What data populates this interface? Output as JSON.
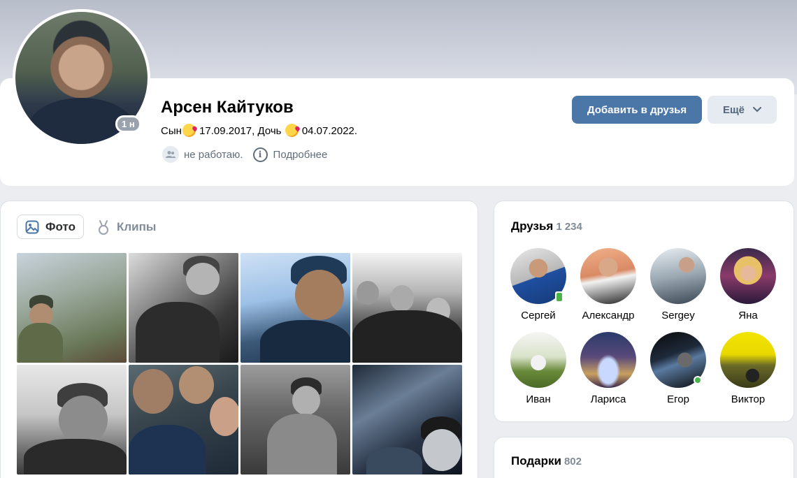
{
  "profile": {
    "name": "Арсен Кайтуков",
    "status_parts": [
      "Сын",
      "17.09.2017, Дочь",
      "04.07.2022."
    ],
    "online_label": "1 н",
    "work": "не работаю.",
    "details": "Подробнее",
    "add_friend": "Добавить в друзья",
    "more": "Ещё"
  },
  "photos": {
    "tabs": [
      {
        "label": "Фото",
        "icon": "image-icon",
        "active": true
      },
      {
        "label": "Клипы",
        "icon": "clips-icon",
        "active": false
      }
    ]
  },
  "friends": {
    "title": "Друзья",
    "count": "1 234",
    "items": [
      {
        "name": "Сергей",
        "online": "mobile"
      },
      {
        "name": "Александр",
        "online": ""
      },
      {
        "name": "Sergey",
        "online": ""
      },
      {
        "name": "Яна",
        "online": ""
      },
      {
        "name": "Иван",
        "online": ""
      },
      {
        "name": "Лариса",
        "online": ""
      },
      {
        "name": "Егор",
        "online": "web"
      },
      {
        "name": "Виктор",
        "online": ""
      }
    ]
  },
  "gifts": {
    "title": "Подарки",
    "count": "802"
  },
  "colors": {
    "accent": "#4a76a8",
    "online": "#4bb34b",
    "muted": "#818c99"
  }
}
